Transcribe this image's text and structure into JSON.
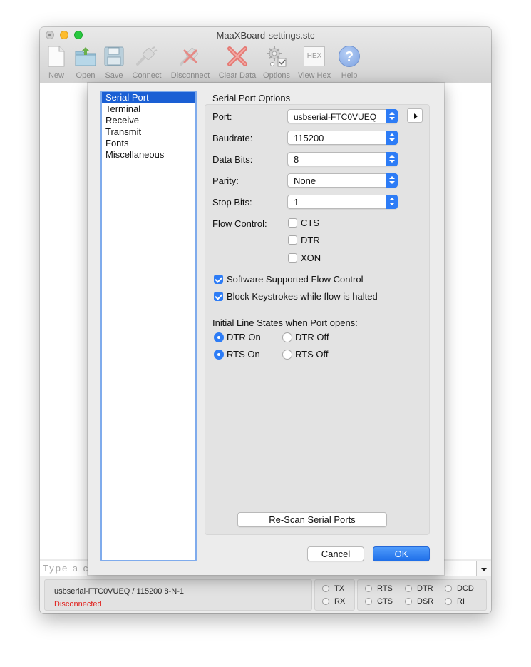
{
  "window": {
    "title": "MaaXBoard-settings.stc"
  },
  "toolbar": [
    {
      "label": "New",
      "icon": "new-document-icon"
    },
    {
      "label": "Open",
      "icon": "open-folder-icon"
    },
    {
      "label": "Save",
      "icon": "save-floppy-icon"
    },
    {
      "label": "Connect",
      "icon": "connect-plug-icon"
    },
    {
      "label": "Disconnect",
      "icon": "disconnect-plug-icon"
    },
    {
      "label": "Clear Data",
      "icon": "clear-x-icon"
    },
    {
      "label": "Options",
      "icon": "options-gear-icon"
    },
    {
      "label": "View Hex",
      "icon": "hex-icon",
      "glyph": "HEX"
    },
    {
      "label": "Help",
      "icon": "help-icon",
      "glyph": "?"
    }
  ],
  "input": {
    "placeholder": "Type a co"
  },
  "status": {
    "info": "usbserial-FTC0VUEQ / 115200 8-N-1",
    "connection": "Disconnected",
    "connection_color": "#e0201c",
    "leds": {
      "tx": "TX",
      "rx": "RX",
      "rts": "RTS",
      "cts": "CTS",
      "dtr": "DTR",
      "dsr": "DSR",
      "dcd": "DCD",
      "ri": "RI"
    }
  },
  "dialog": {
    "categories": [
      "Serial Port",
      "Terminal",
      "Receive",
      "Transmit",
      "Fonts",
      "Miscellaneous"
    ],
    "selected_category": "Serial Port",
    "group_title": "Serial Port Options",
    "port": {
      "label": "Port:",
      "value": "usbserial-FTC0VUEQ"
    },
    "baudrate": {
      "label": "Baudrate:",
      "value": "115200"
    },
    "data_bits": {
      "label": "Data Bits:",
      "value": "8"
    },
    "parity": {
      "label": "Parity:",
      "value": "None"
    },
    "stop_bits": {
      "label": "Stop Bits:",
      "value": "1"
    },
    "flow_control": {
      "label": "Flow Control:",
      "cts": {
        "label": "CTS",
        "checked": false
      },
      "dtr": {
        "label": "DTR",
        "checked": false
      },
      "xon": {
        "label": "XON",
        "checked": false
      }
    },
    "software_flow": {
      "label": "Software Supported Flow Control",
      "checked": true
    },
    "block_keystrokes": {
      "label": "Block Keystrokes while flow is halted",
      "checked": true
    },
    "initial_states": {
      "label": "Initial Line States when Port opens:",
      "dtr_on": "DTR On",
      "dtr_off": "DTR Off",
      "rts_on": "RTS On",
      "rts_off": "RTS Off",
      "dtr_selected": "DTR On",
      "rts_selected": "RTS On"
    },
    "rescan": "Re-Scan Serial Ports",
    "cancel": "Cancel",
    "ok": "OK"
  },
  "colors": {
    "accent": "#2d7cf6",
    "selection": "#1a5fd4",
    "list_border": "#7fabec"
  }
}
